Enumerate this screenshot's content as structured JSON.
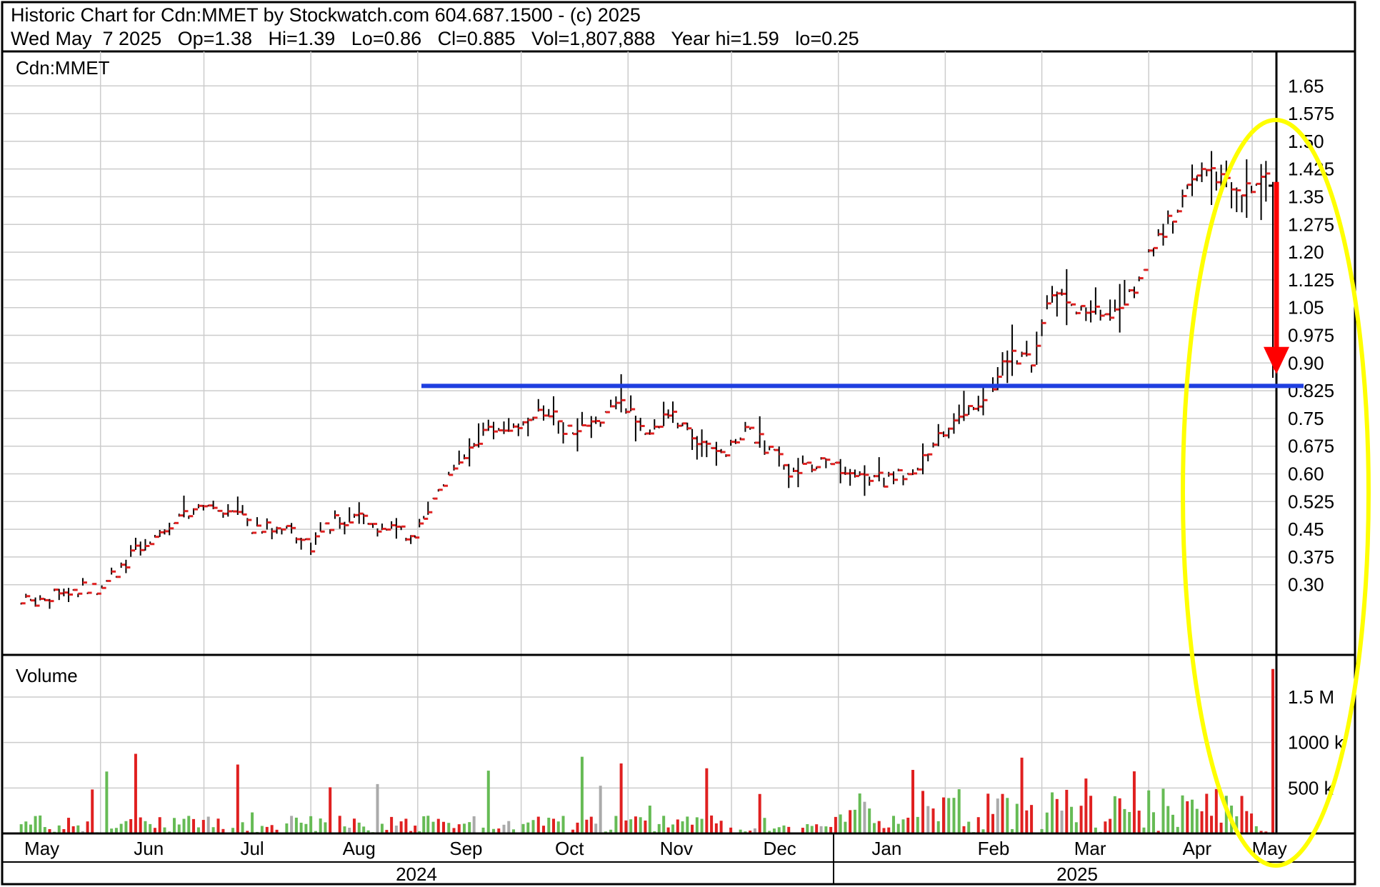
{
  "header": {
    "title_line": "Historic Chart for Cdn:MMET by Stockwatch.com 604.687.1500 - (c) 2025",
    "stats_line": "Wed May  7 2025   Op=1.38   Hi=1.39   Lo=0.86   Cl=0.885   Vol=1,807,888   Year hi=1.59   lo=0.25"
  },
  "price_panel": {
    "label": "Cdn:MMET"
  },
  "volume_panel": {
    "label": "Volume"
  },
  "colors": {
    "bar_up": "#000000",
    "close_tick": "#e02020",
    "vol_up": "#66bb55",
    "vol_down": "#e02020",
    "vol_flat": "#aaaaaa",
    "support_line": "#1f3fe0",
    "arrow": "#ff0000",
    "ellipse": "#ffff00",
    "grid": "#cccccc"
  },
  "annotations": {
    "support_level": 0.838,
    "arrow_from": 1.39,
    "arrow_to": 0.87,
    "ellipse_note": "yellow ellipse highlighting Apr–May 2025 action"
  },
  "chart_data": {
    "type": "ohlc",
    "x_axis": {
      "months": [
        "May",
        "Jun",
        "Jul",
        "Aug",
        "Sep",
        "Oct",
        "Nov",
        "Dec",
        "Jan",
        "Feb",
        "Mar",
        "Apr",
        "May"
      ],
      "years": [
        "2024",
        "2025"
      ],
      "range": [
        "2024-05-07",
        "2025-05-07"
      ]
    },
    "price_axis": {
      "ticks": [
        0.3,
        0.375,
        0.45,
        0.525,
        0.6,
        0.675,
        0.75,
        0.825,
        0.9,
        0.975,
        1.05,
        1.125,
        1.2,
        1.275,
        1.35,
        1.425,
        1.5,
        1.575,
        1.65
      ],
      "tick_labels": [
        "0.30",
        "0.375",
        "0.45",
        "0.525",
        "0.60",
        "0.675",
        "0.75",
        "0.825",
        "0.90",
        "0.975",
        "1.05",
        "1.125",
        "1.20",
        "1.275",
        "1.35",
        "1.425",
        "1.50",
        "1.575",
        "1.65"
      ],
      "ylim": [
        0.225,
        1.695
      ]
    },
    "volume_axis": {
      "ticks": [
        500000,
        1000000,
        1500000
      ],
      "tick_labels": [
        "500 k",
        "1000 k",
        "1.5 M"
      ],
      "ylim": [
        0,
        1900000
      ]
    },
    "grid": true,
    "price_series": [
      {
        "date": "2024-05-09",
        "close": 0.25
      },
      {
        "date": "2024-05-20",
        "close": 0.28
      },
      {
        "date": "2024-05-31",
        "close": 0.29
      },
      {
        "date": "2024-06-07",
        "close": 0.35
      },
      {
        "date": "2024-06-14",
        "close": 0.41
      },
      {
        "date": "2024-06-21",
        "close": 0.47
      },
      {
        "date": "2024-06-28",
        "close": 0.51
      },
      {
        "date": "2024-07-08",
        "close": 0.51
      },
      {
        "date": "2024-07-15",
        "close": 0.46
      },
      {
        "date": "2024-07-25",
        "close": 0.45
      },
      {
        "date": "2024-08-01",
        "close": 0.41
      },
      {
        "date": "2024-08-08",
        "close": 0.47
      },
      {
        "date": "2024-08-15",
        "close": 0.48
      },
      {
        "date": "2024-08-23",
        "close": 0.45
      },
      {
        "date": "2024-08-30",
        "close": 0.43
      },
      {
        "date": "2024-09-04",
        "close": 0.5
      },
      {
        "date": "2024-09-10",
        "close": 0.58
      },
      {
        "date": "2024-09-16",
        "close": 0.66
      },
      {
        "date": "2024-09-20",
        "close": 0.72
      },
      {
        "date": "2024-09-26",
        "close": 0.73
      },
      {
        "date": "2024-10-03",
        "close": 0.74
      },
      {
        "date": "2024-10-09",
        "close": 0.77
      },
      {
        "date": "2024-10-16",
        "close": 0.7
      },
      {
        "date": "2024-10-24",
        "close": 0.74
      },
      {
        "date": "2024-10-30",
        "close": 0.8
      },
      {
        "date": "2024-11-06",
        "close": 0.71
      },
      {
        "date": "2024-11-14",
        "close": 0.76
      },
      {
        "date": "2024-11-21",
        "close": 0.7
      },
      {
        "date": "2024-11-28",
        "close": 0.64
      },
      {
        "date": "2024-12-05",
        "close": 0.73
      },
      {
        "date": "2024-12-12",
        "close": 0.66
      },
      {
        "date": "2024-12-19",
        "close": 0.6
      },
      {
        "date": "2024-12-27",
        "close": 0.63
      },
      {
        "date": "2025-01-03",
        "close": 0.61
      },
      {
        "date": "2025-01-10",
        "close": 0.59
      },
      {
        "date": "2025-01-17",
        "close": 0.58
      },
      {
        "date": "2025-01-24",
        "close": 0.63
      },
      {
        "date": "2025-01-30",
        "close": 0.7
      },
      {
        "date": "2025-02-05",
        "close": 0.77
      },
      {
        "date": "2025-02-12",
        "close": 0.8
      },
      {
        "date": "2025-02-19",
        "close": 0.92
      },
      {
        "date": "2025-02-26",
        "close": 0.9
      },
      {
        "date": "2025-03-04",
        "close": 1.1
      },
      {
        "date": "2025-03-11",
        "close": 1.05
      },
      {
        "date": "2025-03-18",
        "close": 1.03
      },
      {
        "date": "2025-03-25",
        "close": 1.05
      },
      {
        "date": "2025-04-01",
        "close": 1.2
      },
      {
        "date": "2025-04-08",
        "close": 1.3
      },
      {
        "date": "2025-04-15",
        "close": 1.42
      },
      {
        "date": "2025-04-22",
        "close": 1.4
      },
      {
        "date": "2025-04-28",
        "close": 1.36
      },
      {
        "date": "2025-05-05",
        "close": 1.4
      },
      {
        "date": "2025-05-07",
        "open": 1.38,
        "high": 1.39,
        "low": 0.86,
        "close": 0.885
      }
    ]
  }
}
